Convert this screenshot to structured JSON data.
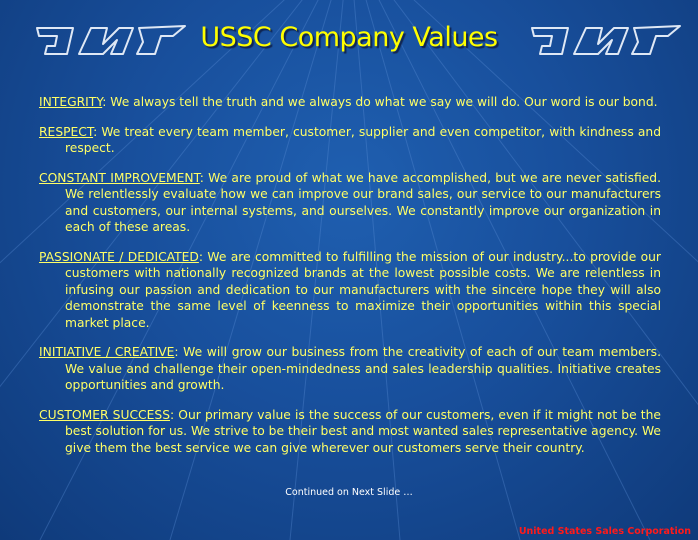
{
  "title": "USSC Company Values",
  "values": [
    {
      "name": "INTEGRITY",
      "text": ": We always tell the truth and we always do what we say we will do. Our word is our bond."
    },
    {
      "name": "RESPECT",
      "text": ": We treat every team member, customer, supplier and even competitor, with kindness and respect."
    },
    {
      "name": "CONSTANT IMPROVEMENT",
      "text": ": We are proud of what we have accomplished, but we are never satisfied. We relentlessly evaluate how we can improve our brand sales, our service to our manufacturers and customers, our internal systems, and ourselves. We constantly improve our organization in each of these areas."
    },
    {
      "name": "PASSIONATE / DEDICATED",
      "text": ": We are committed to fulfilling the mission of our industry...to provide our customers with nationally recognized brands at the lowest possible costs.  We are relentless in infusing our passion and dedication to our manufacturers with the sincere hope they will also demonstrate the same level of keenness to maximize their opportunities within this special market place."
    },
    {
      "name": "INITIATIVE / CREATIVE",
      "text": ": We will grow our business from the creativity of each of our team members. We value and challenge their open-mindedness and sales leadership qualities. Initiative creates opportunities and growth."
    },
    {
      "name": "CUSTOMER SUCCESS",
      "text": ": Our primary value is the success of our customers, even if it might not be the best solution for us. We strive to be their best and most wanted sales representative agency. We give them the best service we can give wherever our customers serve their country."
    }
  ],
  "continued": "Continued on Next Slide …",
  "footer": "United States Sales Corporation",
  "colors": {
    "background": "#184f9c",
    "title": "#ffff00",
    "body_text": "#ffff66",
    "footer": "#ff1a1a"
  },
  "icons": [
    "wings-logo-icon"
  ]
}
